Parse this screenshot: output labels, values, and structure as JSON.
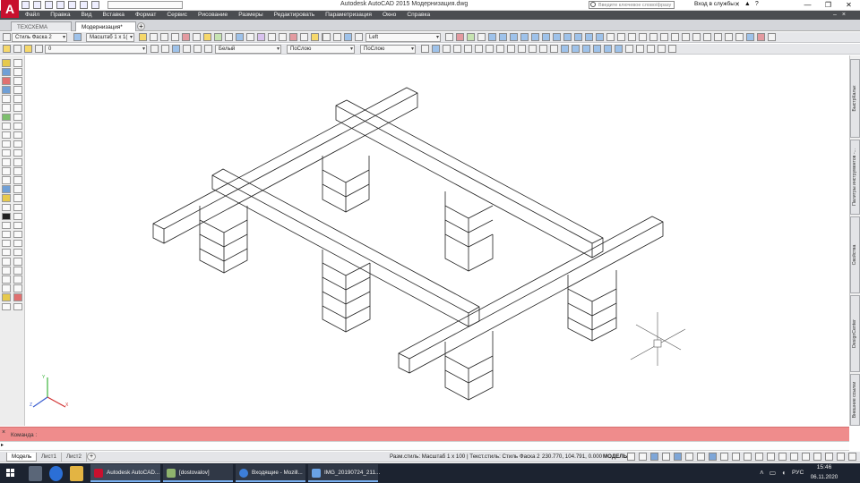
{
  "window": {
    "title": "Autodesk AutoCAD 2015    Модернизация.dwg",
    "app_logo": "A",
    "search_placeholder": "Введите ключевое слово/фразу",
    "login": "Вход в службы",
    "controls": [
      "—",
      "❐",
      "✕"
    ]
  },
  "menu": {
    "items": [
      "Файл",
      "Правка",
      "Вид",
      "Вставка",
      "Формат",
      "Сервис",
      "Рисование",
      "Размеры",
      "Редактировать",
      "Параметризация",
      "Окно",
      "Справка"
    ]
  },
  "tabs": [
    {
      "label": "ТЕХСХЕМА ноябрь*",
      "active": false
    },
    {
      "label": "Модернизация*",
      "active": true
    }
  ],
  "toolbar": {
    "text_style": "Стиль Фаска 2",
    "dim_scale": "Масштаб 1 х 1(",
    "view_name": "Left",
    "layer": "0",
    "color": "Белый",
    "linetype": "ПоСлою",
    "lineweight": "ПоСлою"
  },
  "right_palettes": [
    "БыстрКальк",
    "Палитры инструментов -...",
    "Свойства",
    "DesignCenter",
    "Внешние ссылки"
  ],
  "command": {
    "label": "Команда :",
    "placeholder": ""
  },
  "layout_tabs": [
    "Модель",
    "Лист1",
    "Лист2"
  ],
  "status": {
    "dim_style": "Разм.стиль: Масштаб 1 х 100 | Текст.стиль: Стиль Фаска 2",
    "coords": "230.770, 104.791, 0.000",
    "space": "МОДЕЛЬ"
  },
  "ucs": {
    "x": "X",
    "y": "Y",
    "z": "Z"
  },
  "taskbar": {
    "tasks": [
      "Autodesk AutoCAD...",
      "[dostovalov]",
      "Входящие - Mozill...",
      "IMG_20190724_211..."
    ],
    "lang": "РУС",
    "time": "15:46",
    "date": "06.11.2020"
  },
  "colors": {
    "menu_bg": "#4b4d51",
    "cmd_bg": "#ef8c8c",
    "taskbar_bg": "#1c2330",
    "accent": "#c8102e"
  }
}
